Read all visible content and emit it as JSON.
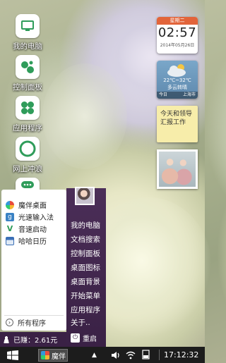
{
  "desktop_icons": [
    {
      "label": "我的电脑",
      "icon": "computer-icon"
    },
    {
      "label": "控制面板",
      "icon": "control-panel-icon"
    },
    {
      "label": "应用程序",
      "icon": "apps-icon"
    },
    {
      "label": "网上冲浪",
      "icon": "browser-icon"
    },
    {
      "label": "",
      "icon": "chat-icon"
    }
  ],
  "widgets": {
    "clock": {
      "weekday": "星期二",
      "time": "02:57",
      "date": "2014年05月26日"
    },
    "weather": {
      "temperature": "22℃~32℃",
      "condition": "多云转晴",
      "day": "今日",
      "city": "上海市"
    },
    "note": {
      "text": "今天和领导汇报工作"
    }
  },
  "start_menu": {
    "left_items": [
      {
        "label": "魔伴桌面",
        "icon": "moban-desktop-icon"
      },
      {
        "label": "光速输入法",
        "icon": "input-method-icon"
      },
      {
        "label": "音速启动",
        "icon": "vstart-icon"
      },
      {
        "label": "哈哈日历",
        "icon": "calendar-icon"
      }
    ],
    "all_programs": "所有程序",
    "right_items": [
      "我的电脑",
      "文档搜索",
      "控制面板",
      "桌面图标",
      "桌面背景",
      "开始菜单",
      "应用程序",
      "关于.."
    ],
    "earnings": "已赚：2.61元",
    "restart": "重启"
  },
  "taskbar": {
    "task_label": "魔伴",
    "clock": "17:12:32"
  }
}
